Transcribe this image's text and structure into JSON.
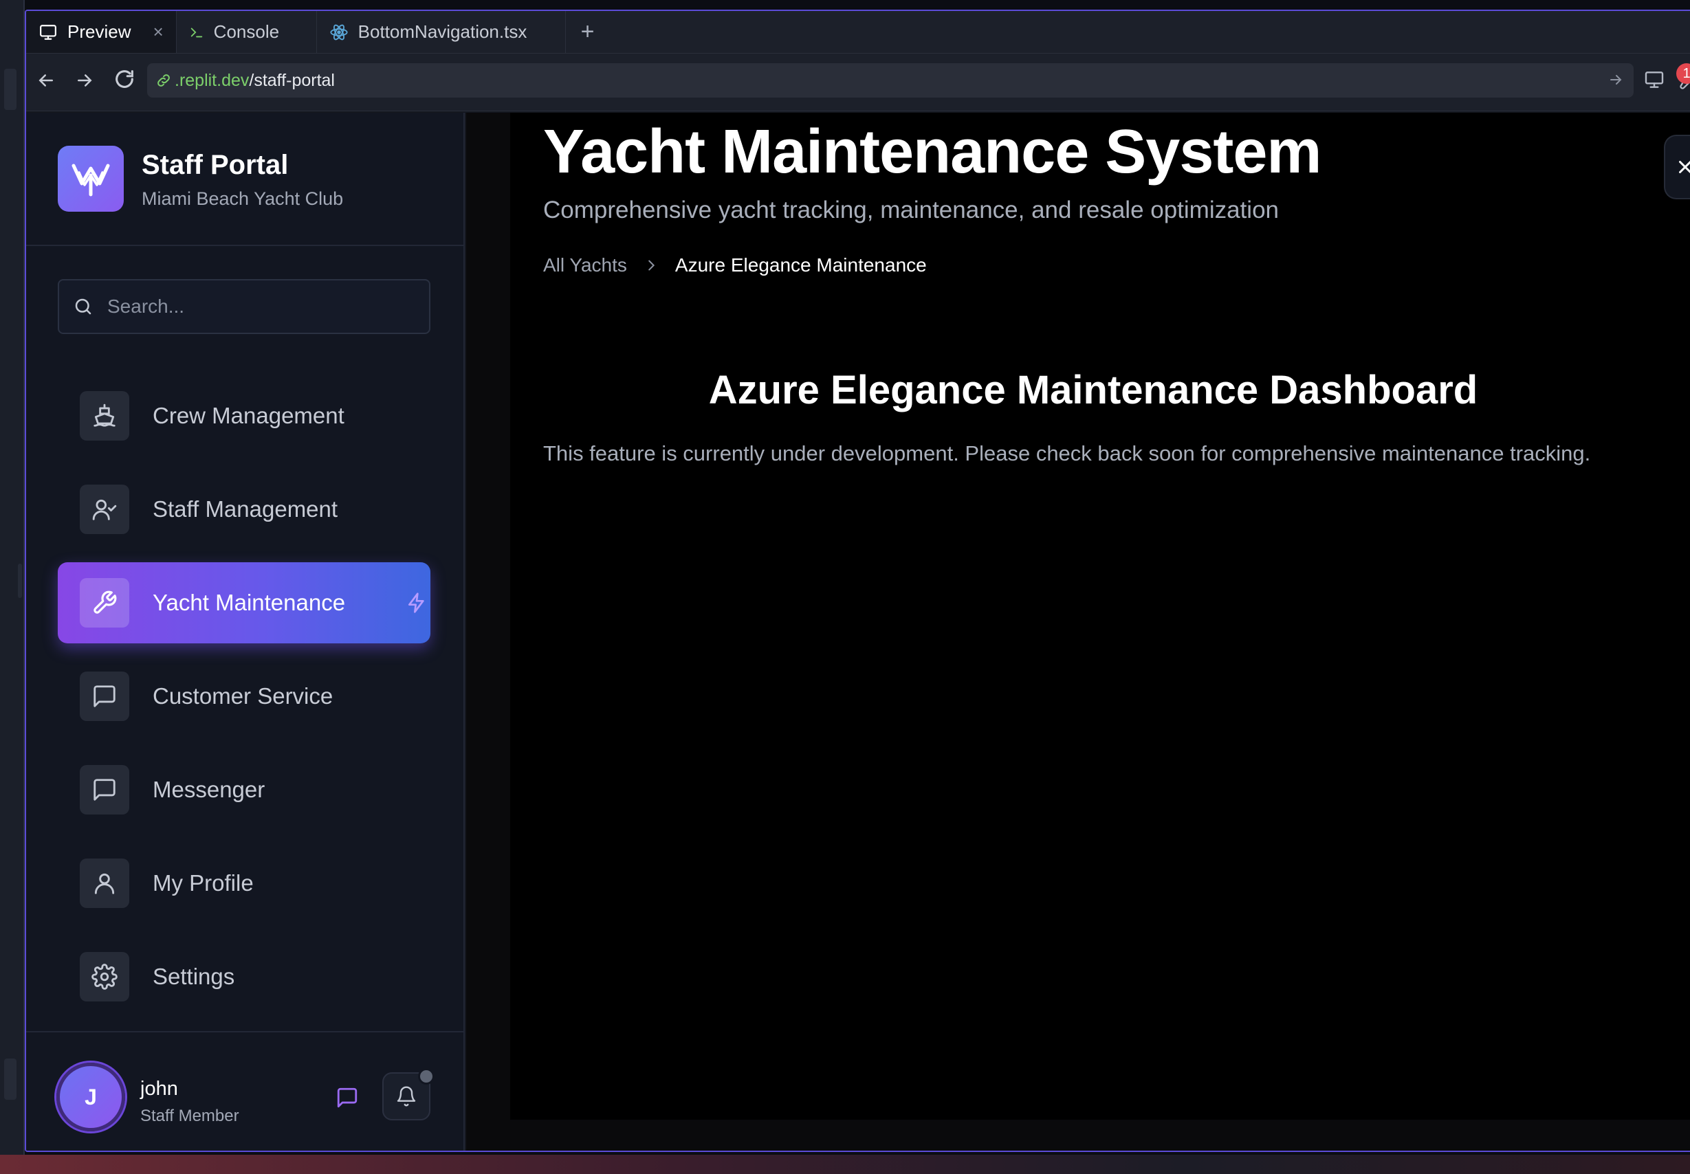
{
  "tabs": [
    {
      "label": "Preview",
      "icon": "monitor-icon",
      "active": true
    },
    {
      "label": "Console",
      "icon": "terminal-icon"
    },
    {
      "label": "BottomNavigation.tsx",
      "icon": "react-icon"
    }
  ],
  "address": {
    "domain": ".replit.dev",
    "path": "/staff-portal",
    "notification_count": "1"
  },
  "sidebar": {
    "title": "Staff Portal",
    "subtitle": "Miami Beach Yacht Club",
    "search_placeholder": "Search...",
    "items": [
      {
        "label": "Crew Management",
        "icon": "ship-icon"
      },
      {
        "label": "Staff Management",
        "icon": "user-check-icon"
      },
      {
        "label": "Yacht Maintenance",
        "icon": "wrench-icon",
        "active": true
      },
      {
        "label": "Customer Service",
        "icon": "message-square-icon"
      },
      {
        "label": "Messenger",
        "icon": "message-square-icon"
      },
      {
        "label": "My Profile",
        "icon": "user-icon"
      },
      {
        "label": "Settings",
        "icon": "gear-icon"
      }
    ],
    "user": {
      "initial": "J",
      "name": "john",
      "role": "Staff Member"
    }
  },
  "main": {
    "title": "Yacht Maintenance System",
    "subtitle": "Comprehensive yacht tracking, maintenance, and resale optimization",
    "breadcrumb": {
      "parent": "All Yachts",
      "current": "Azure Elegance Maintenance"
    },
    "dashboard_title": "Azure Elegance Maintenance Dashboard",
    "dashboard_message": "This feature is currently under development. Please check back soon for comprehensive maintenance tracking."
  },
  "colors": {
    "accent_purple": "#8747e6",
    "accent_blue": "#3e67e0",
    "sidebar_bg": "#121621",
    "content_bg": "#000000",
    "url_domain": "#7ccf6a",
    "badge": "#e3474f"
  }
}
